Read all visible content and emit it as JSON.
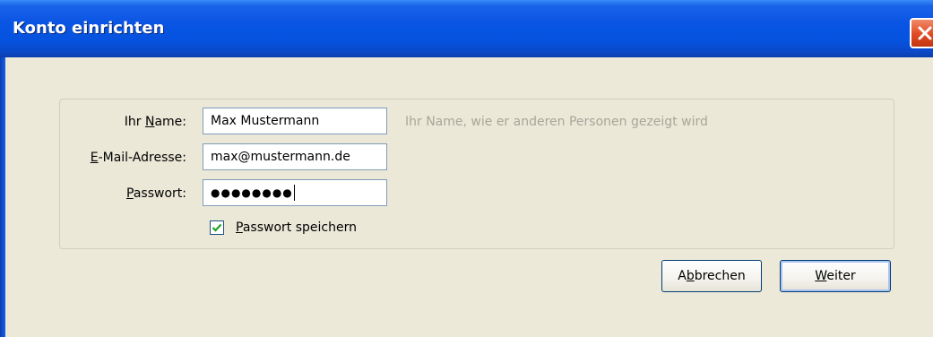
{
  "window": {
    "title": "Konto einrichten",
    "close_icon": "close-icon"
  },
  "form": {
    "name": {
      "label_before": "Ihr ",
      "label_accel": "N",
      "label_after": "ame:",
      "value": "Max Mustermann",
      "hint": "Ihr Name, wie er anderen Personen gezeigt wird"
    },
    "email": {
      "label_accel": "E",
      "label_after": "-Mail-Adresse:",
      "value": "max@mustermann.de"
    },
    "password": {
      "label_accel": "P",
      "label_after": "asswort:",
      "masked_value": "●●●●●●●●"
    },
    "remember": {
      "checked": true,
      "label_accel": "P",
      "label_after": "asswort speichern"
    }
  },
  "buttons": {
    "cancel": {
      "before": "A",
      "accel": "b",
      "after": "brechen"
    },
    "next": {
      "before": "",
      "accel": "W",
      "after": "eiter"
    }
  },
  "colors": {
    "titlebar": "#0553e0",
    "dialog_bg": "#ece9d8",
    "hint_text": "#a8a69a",
    "close_red": "#e04a22"
  }
}
